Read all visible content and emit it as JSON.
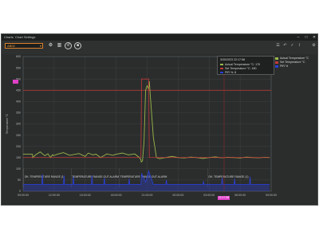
{
  "window": {
    "tabs": [
      "Charts",
      "Chart Settings"
    ],
    "controls": [
      "–",
      "□",
      "✕"
    ]
  },
  "toolbar": {
    "device_select": "AB02",
    "icons": [
      "device-settings-icon",
      "bar-chart-icon",
      "reset-icon",
      "stop-icon"
    ],
    "right_icons": [
      "list-icon",
      "undo-icon",
      "check-icon",
      "chart-icon",
      "gear-icon"
    ]
  },
  "tooltip": {
    "time": "3/30/2023 22:17:58",
    "rows": [
      {
        "color": "#9ab84a",
        "text": "Actual Temperature °C: 170"
      },
      {
        "color": "#c43a3a",
        "text": "Set Temperature °C: 180"
      },
      {
        "color": "#2b3fd6",
        "text": "PIR %: 8"
      }
    ]
  },
  "legend": [
    {
      "color": "#9ab84a",
      "label": "Actual Temperature °C"
    },
    {
      "color": "#c43a3a",
      "label": "Set Temperature °C"
    },
    {
      "color": "#2b3fd6",
      "label": "PIR %"
    }
  ],
  "chart_data": {
    "type": "line",
    "ylabel": "Temperature °C",
    "y_ticks": [
      0,
      50,
      100,
      150,
      200,
      250,
      300,
      350,
      400,
      450,
      500,
      550,
      600
    ],
    "ylim": [
      0,
      600
    ],
    "x_ticks": [
      "09:00:00",
      "12:00:00",
      "15:00:00",
      "18:00:00",
      "21:00:00",
      "00:00:00",
      "03:00:00",
      "06:00:00",
      "09:00:00"
    ],
    "x_selected_label": "22:17:58",
    "set_temperature_reference": 450,
    "series": [
      {
        "name": "Actual Temperature °C",
        "color": "#9ab84a",
        "x": [
          0,
          0.3,
          0.31,
          0.4,
          0.55,
          0.7,
          0.8,
          0.88,
          0.95,
          0.97,
          1.1,
          1.3,
          1.5,
          1.8,
          2.0,
          2.1,
          2.25,
          2.35,
          2.5,
          2.7,
          2.9,
          3.0,
          3.2,
          3.4,
          3.6,
          3.75,
          3.8,
          3.81,
          3.85,
          3.9,
          3.95,
          4.0,
          4.05,
          4.07,
          4.1,
          4.2,
          4.3,
          4.4,
          4.6,
          4.8,
          5.0,
          5.2,
          5.4,
          5.6,
          5.8,
          6.0,
          6.2,
          6.4,
          6.6,
          6.8,
          7.0,
          7.2,
          7.4,
          7.6,
          7.8,
          7.95
        ],
        "values": [
          165,
          165,
          150,
          162,
          175,
          158,
          167,
          150,
          163,
          158,
          165,
          172,
          160,
          168,
          155,
          170,
          162,
          165,
          150,
          166,
          160,
          165,
          170,
          162,
          166,
          150,
          140,
          130,
          135,
          220,
          450,
          470,
          455,
          490,
          430,
          240,
          150,
          145,
          150,
          155,
          150,
          148,
          152,
          150,
          146,
          150,
          153,
          149,
          151,
          150,
          148,
          152,
          150,
          149,
          151,
          150
        ]
      },
      {
        "name": "Set Temperature °C",
        "color": "#c43a3a",
        "x": [
          0,
          3.8,
          3.82,
          4.05,
          4.07,
          4.6,
          4.62,
          7.95
        ],
        "values": [
          150,
          150,
          500,
          500,
          150,
          150,
          150,
          150
        ]
      },
      {
        "name": "PIR %",
        "color": "#2b3fd6",
        "x": [
          0,
          0.6,
          0.62,
          0.64,
          1.3,
          1.32,
          1.34,
          1.6,
          1.62,
          1.64,
          2.2,
          2.22,
          2.24,
          2.6,
          2.62,
          2.64,
          3.4,
          3.42,
          3.44,
          3.8,
          3.82,
          3.95,
          4.05,
          4.2,
          4.6,
          4.62,
          4.64,
          5.8,
          5.82,
          5.84,
          6.4,
          6.42,
          6.44,
          6.8,
          6.82,
          6.84,
          7.3,
          7.32,
          7.34,
          7.95
        ],
        "values": [
          30,
          30,
          75,
          30,
          30,
          70,
          30,
          30,
          65,
          30,
          30,
          70,
          30,
          30,
          60,
          30,
          30,
          55,
          30,
          30,
          80,
          40,
          90,
          30,
          30,
          50,
          30,
          30,
          45,
          30,
          30,
          60,
          30,
          30,
          55,
          30,
          30,
          65,
          30,
          30
        ]
      }
    ],
    "event_markers": [
      {
        "x": 0.02,
        "label": "OK: TEMPERATURE RANGE (1)"
      },
      {
        "x": 1.55,
        "label": "TEMPERATURE RANGE OUT ALARM"
      },
      {
        "x": 3.1,
        "label": "TEMPERATURE RANGE OUT ALARM"
      },
      {
        "x": 5.95,
        "label": "OK: TEMPERATURE RANGE (1)"
      }
    ],
    "grid": true,
    "legend_position": "top-right"
  }
}
